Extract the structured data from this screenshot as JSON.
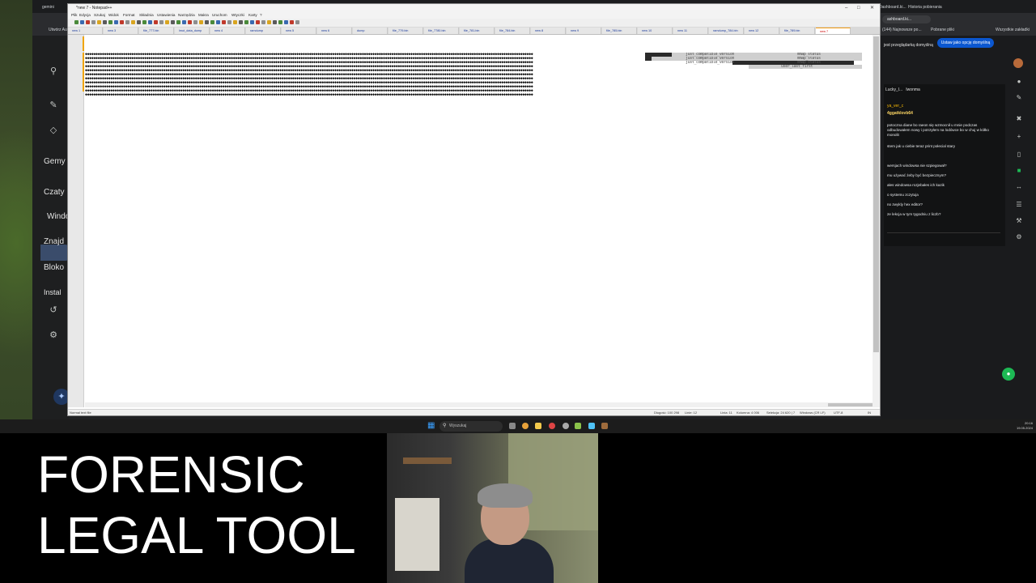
{
  "browser": {
    "tabs": [
      {
        "label": "gemini"
      },
      {
        "label": "Dashboard.ki..."
      },
      {
        "label": "Historia pobierania"
      }
    ],
    "omnibox": "ashboard.ki...",
    "bookmarks": [
      "Utwórz Aut...",
      "(144) Najnowsze po...",
      "Pobrane pliki",
      "Wszystkie zakładki"
    ],
    "default_banner": "jest przeglądarką domyślną",
    "default_button": "Ustaw jako opcję domyślną"
  },
  "gemini_nav": {
    "items": [
      "Gemy",
      "Czaty",
      "Windo",
      "Znajd",
      "Bloko",
      "Instal"
    ]
  },
  "chat": {
    "tabs": [
      "Lucky_l...",
      "Iwonma"
    ],
    "user": "ya_ver_c",
    "subtitle": "4ggatklovb64",
    "messages": [
      "potoczna diane bo raeon się wzmocnił u mnie podczas odbudowałem nowy i potrzyłem na lodówce bo w chuj w kółko monolit",
      "stem jak u ciebie teraz print połecial stary",
      "wersjach windowsa nie szpiegował?",
      "mu używać żeby być bezpiecznym?",
      "ałes windowsa rozjebałes ich kazik",
      "o systemu zczytuja",
      "no zwykly hex editor?",
      "ze lekcja w tym tygodniu z liczb?"
    ]
  },
  "notepad": {
    "title": "*new 7 - Notepad++",
    "menu": [
      "Plik",
      "Edycja",
      "Szukaj",
      "Widok",
      "Format",
      "Składnia",
      "Ustawienia",
      "Narzędzia",
      "Makra",
      "Uruchom",
      "Wtyczki",
      "Karty",
      "?"
    ],
    "tabs": [
      "new 1",
      "new 3",
      "file_777.bin",
      "lmut_data_dump",
      "new 4",
      "ramdump",
      "new 5",
      "new 6",
      "dump",
      "file_779.bin",
      "file_7780.bin",
      "file_781.bin",
      "file_784.bin",
      "new 8",
      "new 9",
      "file_785.bin",
      "new 10",
      "new 11",
      "ramdump_784.bin",
      "new 12",
      "file_789.bin",
      "new 7"
    ],
    "active_tab": "new 7",
    "binary_line": "◆◆◆◆◆◆◆◆◆◆◆◆◆◆◆◆◆◆◆◆◆◆◆◆◆◆◆◆◆◆◆◆◆◆◆◆◆◆◆◆◆◆◆◆◆◆◆◆◆◆◆◆◆◆◆◆◆◆◆◆◆◆◆◆◆◆◆◆◆◆◆◆◆◆◆◆◆◆◆◆◆◆◆◆◆◆◆◆◆◆◆◆◆◆◆◆◆◆◆◆◆◆◆◆◆◆◆◆◆◆◆◆◆◆◆◆◆◆◆◆◆◆◆◆◆◆◆◆◆◆◆◆◆◆◆◆◆◆◆◆◆◆◆◆◆◆◆◆◆◆◆◆◆◆◆◆◆◆◆◆◆◆◆◆◆◆◆◆◆◆◆◆◆◆◆◆◆◆◆◆◆◆◆◆◆◆◆◆◆◆◆◆◆◆◆◆◆◆◆◆◆◆◆◆◆◆◆◆◆◆◆◆",
    "fragments": [
      "just_compatible_version",
      "mmap_status",
      "just_compatible_version",
      "mmap_status",
      "just_compatible_version",
      "mmap_status",
      "user_last_first"
    ],
    "status": {
      "type": "Normal text file",
      "length": "Długość: 100 298",
      "lines": "Linie: 12",
      "position": "Linia: 11",
      "column": "Kolumna: 4 006",
      "selection": "Selekcja: 24 620 | 7",
      "eol": "Windows (CR LF)",
      "encoding": "UTF-8",
      "mode": "IN"
    }
  },
  "taskbar": {
    "search_placeholder": "Wyszukaj",
    "time": "20:16",
    "date": "19.05.2024"
  },
  "overlay": {
    "title_line1": "FORENSIC",
    "title_line2": "LEGAL TOOL"
  },
  "colors": {
    "accent_orange": "#f0a500",
    "chrome_dark": "#202124",
    "default_button_blue": "#0b57d0",
    "chat_user_yellow": "#fbbc04",
    "npp_active_tab_red": "#cc0000"
  }
}
